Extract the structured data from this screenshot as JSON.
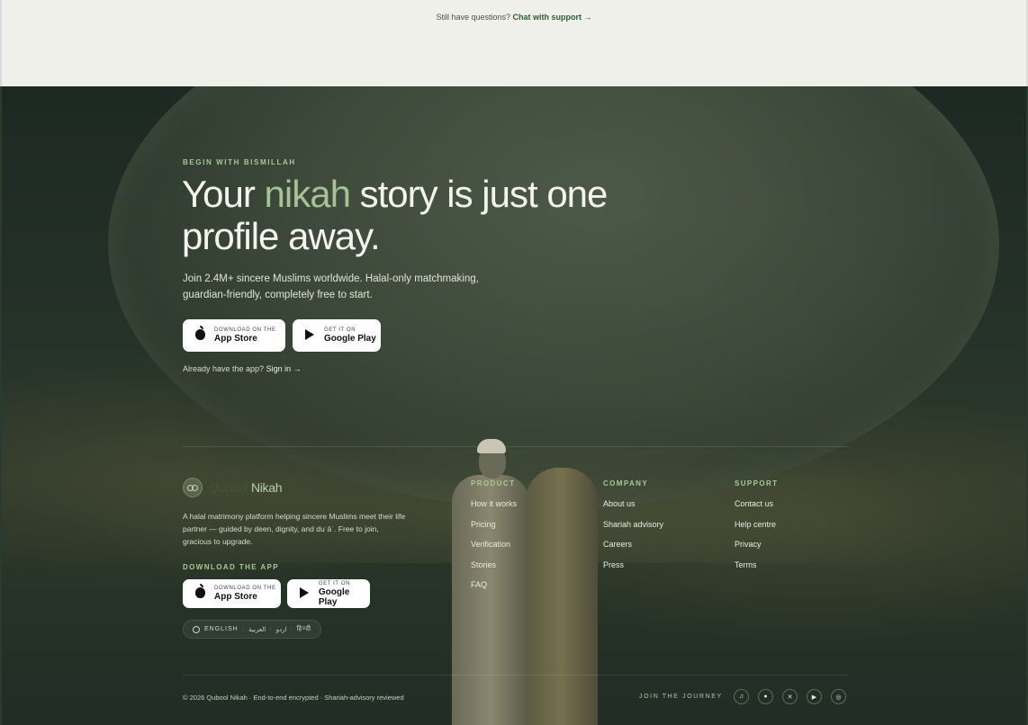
{
  "top": {
    "question": "Still have questions?",
    "chat_link": "Chat with support →"
  },
  "hero": {
    "eyebrow": "BEGIN WITH BISMILLAH",
    "headline_part1": "Your ",
    "headline_accent": "nikah",
    "headline_part2": " story is just one profile away.",
    "subtext": "Join 2.4M+ sincere Muslims worldwide. Halal-only matchmaking, guardian-friendly, completely free to start.",
    "app_store": {
      "small": "DOWNLOAD ON THE",
      "big": "App Store"
    },
    "google_play": {
      "small": "GET IT ON",
      "big": "Google Play"
    },
    "signin_prefix": "Already have the app? ",
    "signin_link": "Sign in →"
  },
  "footer": {
    "brand_part1": "Qubool ",
    "brand_part2": "Nikah",
    "about": "A halal matrimony platform helping sincere Muslims meet their life partner — guided by deen, dignity, and duʿāʾ. Free to join, gracious to upgrade.",
    "download_label": "DOWNLOAD THE APP",
    "app_store": {
      "small": "DOWNLOAD ON THE",
      "big": "App Store"
    },
    "google_play": {
      "small": "GET IT ON",
      "big": "Google Play"
    },
    "languages": [
      "ENGLISH",
      "العربية",
      "اردو",
      "हिन्दी"
    ],
    "columns": [
      {
        "heading": "PRODUCT",
        "links": [
          "How it works",
          "Pricing",
          "Verification",
          "Stories",
          "FAQ"
        ]
      },
      {
        "heading": "COMPANY",
        "links": [
          "About us",
          "Shariah advisory",
          "Careers",
          "Press"
        ]
      },
      {
        "heading": "SUPPORT",
        "links": [
          "Contact us",
          "Help centre",
          "Privacy",
          "Terms"
        ]
      }
    ],
    "copyright": "© 2026 Qubool Nikah · End-to-end encrypted · Shariah-advisory reviewed",
    "journey": "JOIN THE JOURNEY",
    "social_icons": [
      "music-icon",
      "mic-icon",
      "x-icon",
      "youtube-icon",
      "instagram-icon"
    ]
  },
  "colors": {
    "accent": "#a9c79a",
    "top_band": "#eff0ea",
    "support_link": "#2f5a35"
  }
}
